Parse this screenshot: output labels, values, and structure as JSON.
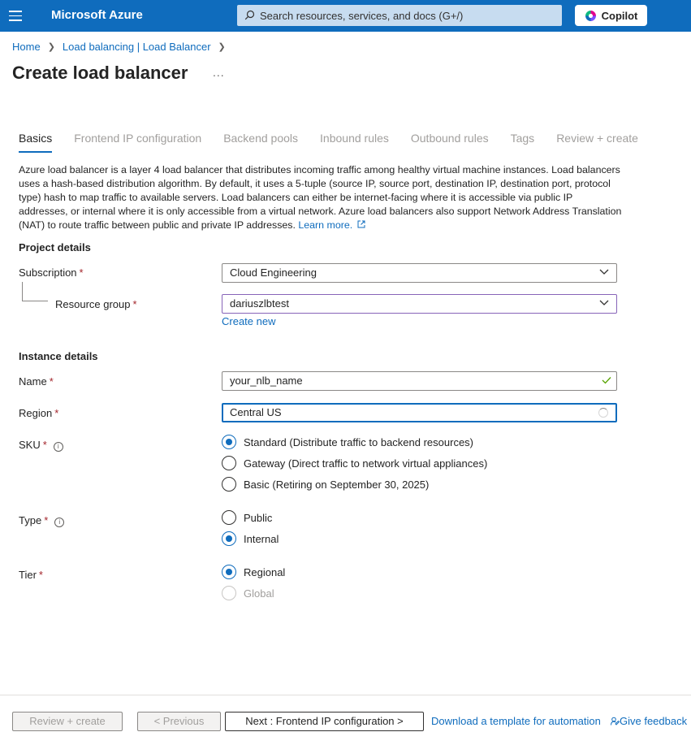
{
  "header": {
    "brand": "Microsoft Azure",
    "search_placeholder": "Search resources, services, and docs (G+/)",
    "copilot_label": "Copilot",
    "accent": "#0f6cbd"
  },
  "breadcrumb": {
    "items": [
      "Home",
      "Load balancing | Load Balancer"
    ]
  },
  "page": {
    "title": "Create load balancer",
    "more": "..."
  },
  "tabs": [
    {
      "label": "Basics",
      "active": true
    },
    {
      "label": "Frontend IP configuration"
    },
    {
      "label": "Backend pools"
    },
    {
      "label": "Inbound rules"
    },
    {
      "label": "Outbound rules"
    },
    {
      "label": "Tags"
    },
    {
      "label": "Review + create"
    }
  ],
  "description": {
    "text": "Azure load balancer is a layer 4 load balancer that distributes incoming traffic among healthy virtual machine instances. Load balancers uses a hash-based distribution algorithm. By default, it uses a 5-tuple (source IP, source port, destination IP, destination port, protocol type) hash to map traffic to available servers. Load balancers can either be internet-facing where it is accessible via public IP addresses, or internal where it is only accessible from a virtual network. Azure load balancers also support Network Address Translation (NAT) to route traffic between public and private IP addresses.",
    "learn_more": "Learn more."
  },
  "project_details": {
    "title": "Project details",
    "subscription_label": "Subscription",
    "subscription_value": "Cloud Engineering",
    "resource_group_label": "Resource group",
    "resource_group_value": "dariuszlbtest",
    "create_new": "Create new"
  },
  "instance_details": {
    "title": "Instance details",
    "name_label": "Name",
    "name_value": "your_nlb_name",
    "region_label": "Region",
    "region_value": "Central US",
    "sku_label": "SKU",
    "sku_options": [
      {
        "label": "Standard (Distribute traffic to backend resources)",
        "checked": true
      },
      {
        "label": "Gateway (Direct traffic to network virtual appliances)",
        "checked": false
      },
      {
        "label": "Basic (Retiring on September 30, 2025)",
        "checked": false
      }
    ],
    "type_label": "Type",
    "type_options": [
      {
        "label": "Public",
        "checked": false
      },
      {
        "label": "Internal",
        "checked": true
      }
    ],
    "tier_label": "Tier",
    "tier_options": [
      {
        "label": "Regional",
        "checked": true
      },
      {
        "label": "Global",
        "checked": false,
        "disabled": true
      }
    ],
    "required_mark": "*"
  },
  "footer": {
    "review_create": "Review + create",
    "previous": "< Previous",
    "next": "Next : Frontend IP configuration >",
    "download_template": "Download a template for automation",
    "give_feedback": "Give feedback"
  }
}
